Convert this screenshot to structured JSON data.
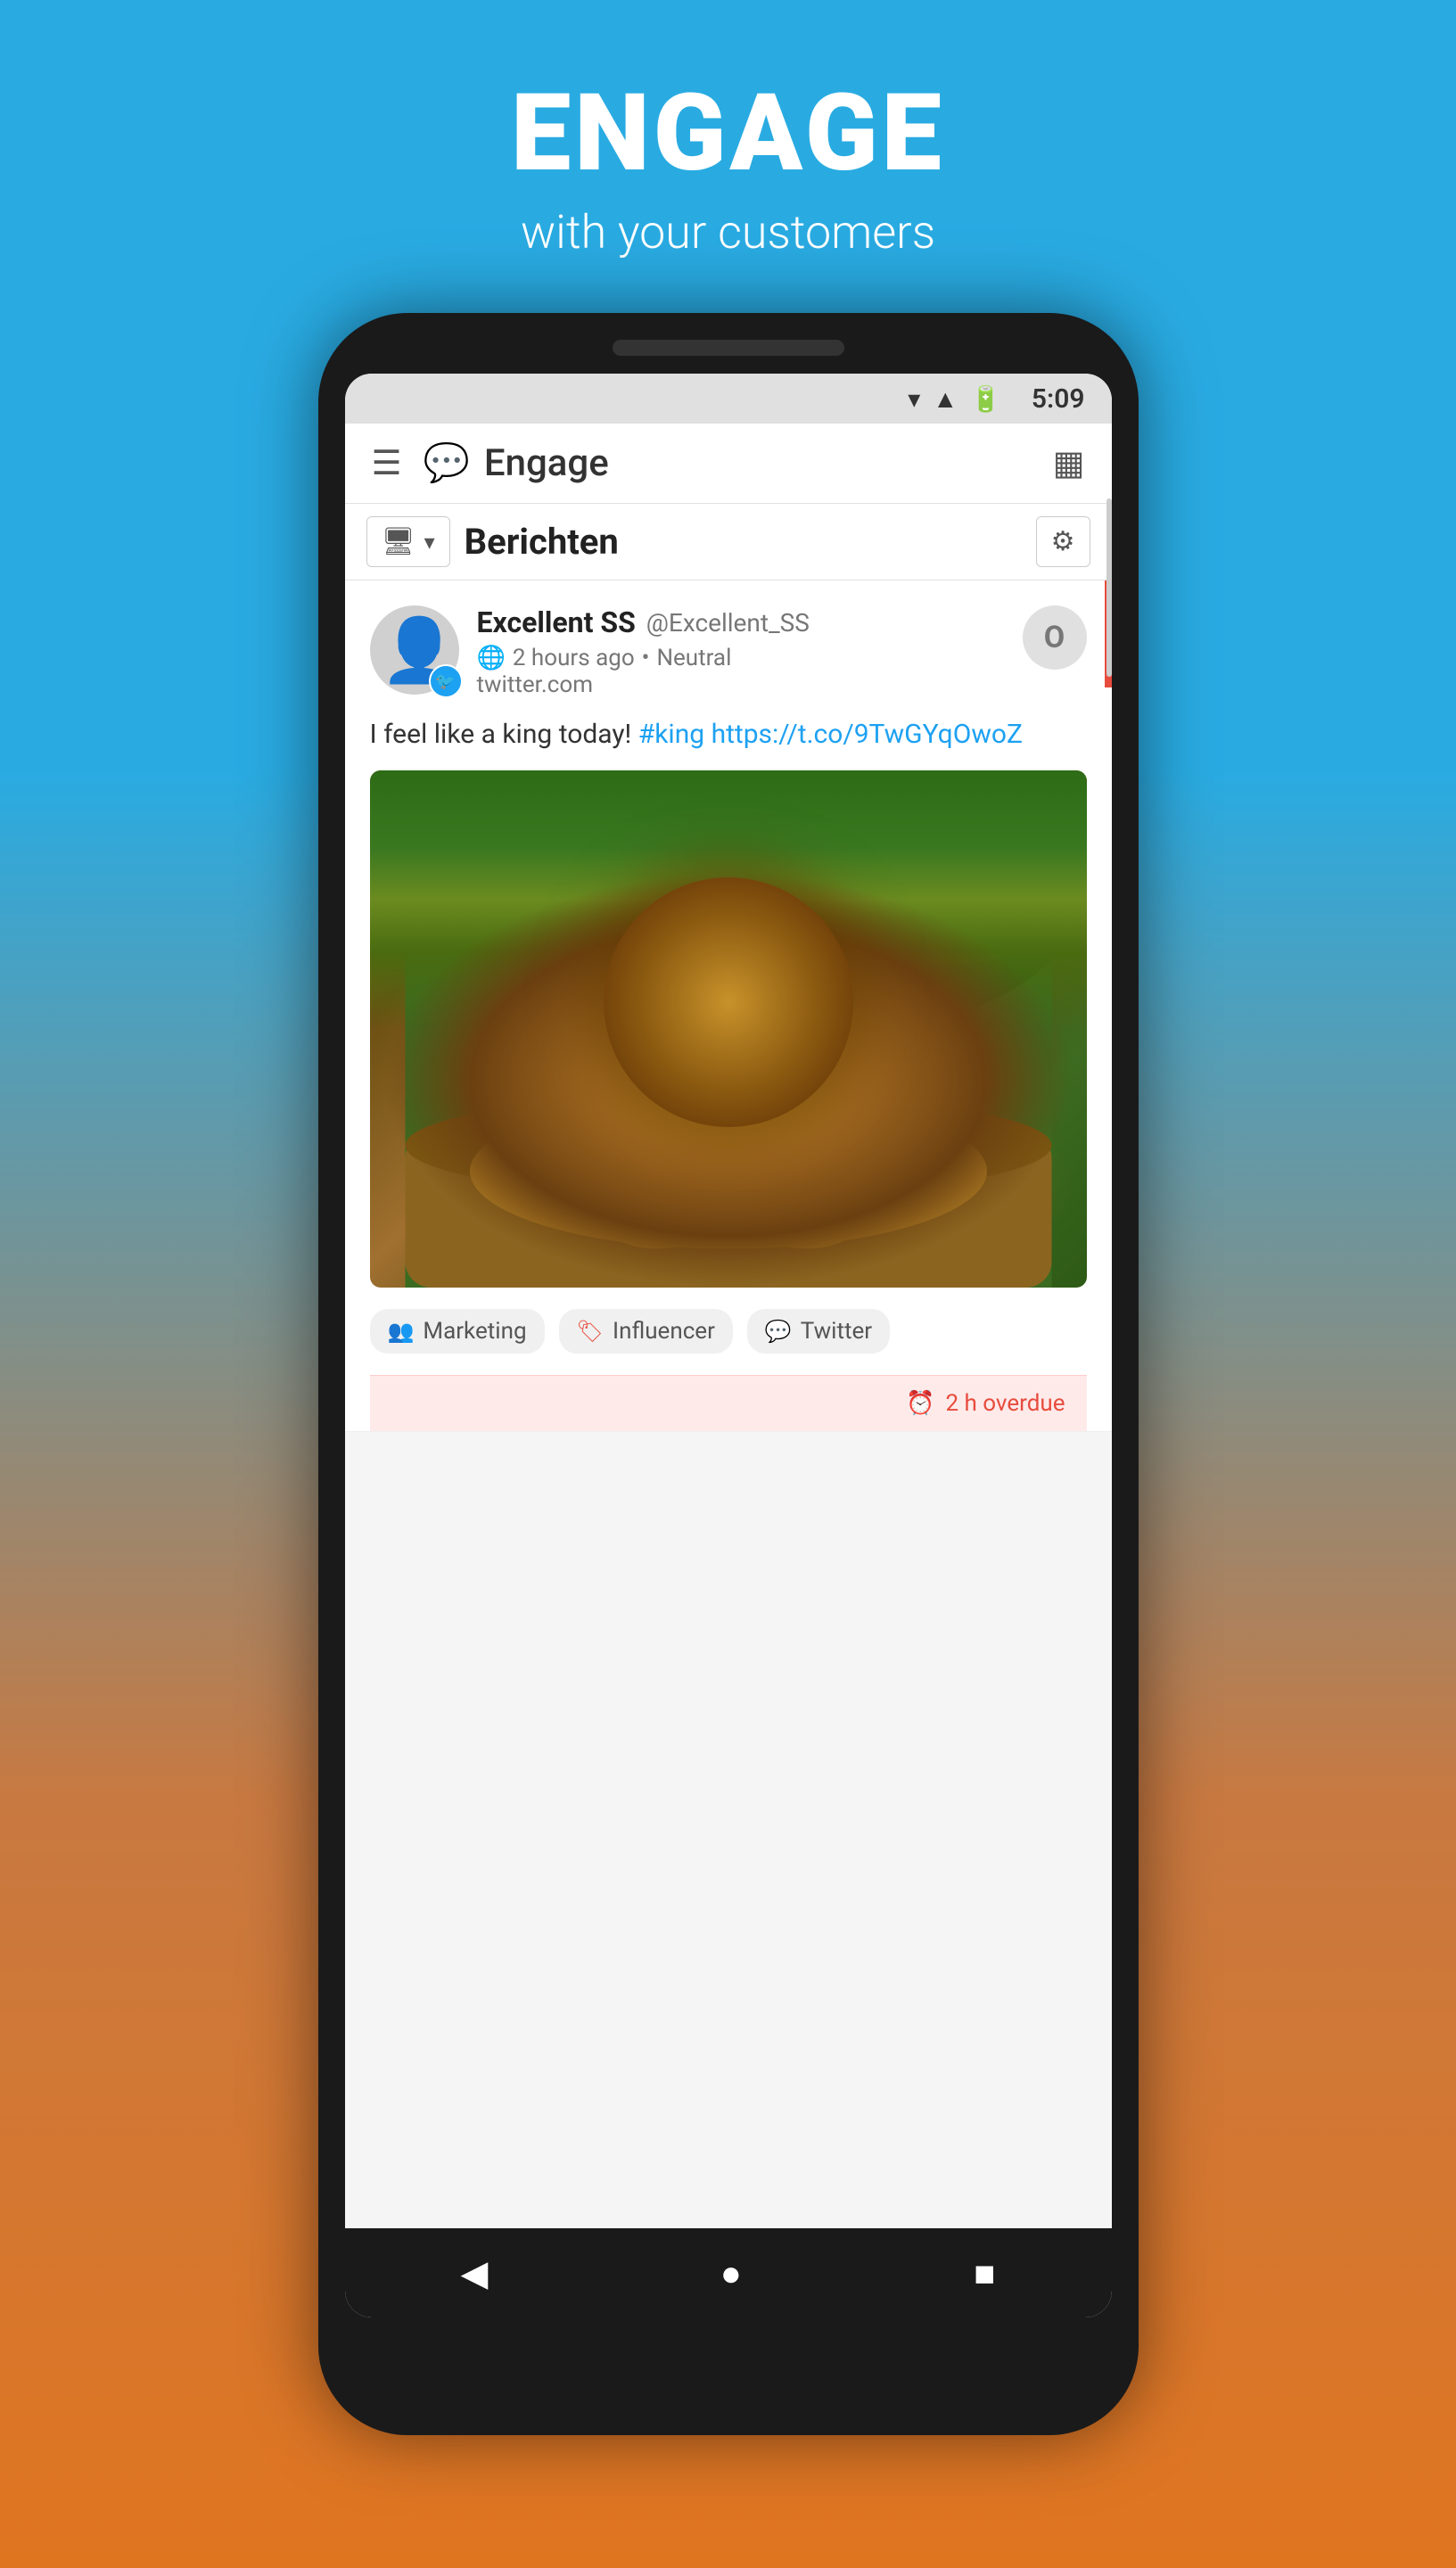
{
  "header": {
    "title": "ENGAGE",
    "subtitle": "with your customers"
  },
  "status_bar": {
    "time": "5:09"
  },
  "app_bar": {
    "title": "Engage",
    "menu_label": "☰",
    "chat_icon_label": "💬",
    "grid_icon_label": "⊞"
  },
  "filter_bar": {
    "title": "Berichten",
    "filter_icon": "🖥",
    "settings_icon": "⚙"
  },
  "message": {
    "user_name": "Excellent SS",
    "user_handle": "@Excellent_SS",
    "time_ago": "2 hours ago",
    "sentiment": "Neutral",
    "source": "twitter.com",
    "reply_label": "O",
    "text_prefix": "I feel like a king today! ",
    "hashtag": "#king",
    "link": "https://t.co/9TwGYqOwoZ"
  },
  "tags": [
    {
      "id": "marketing",
      "label": "Marketing",
      "icon": "👥",
      "type": "marketing"
    },
    {
      "id": "influencer",
      "label": "Influencer",
      "icon": "🏷",
      "type": "influencer"
    },
    {
      "id": "twitter",
      "label": "Twitter",
      "icon": "💬",
      "type": "twitter"
    }
  ],
  "overdue": {
    "label": "2 h overdue",
    "icon": "⏰"
  },
  "nav": {
    "back": "◀",
    "home": "●",
    "recent": "■"
  }
}
